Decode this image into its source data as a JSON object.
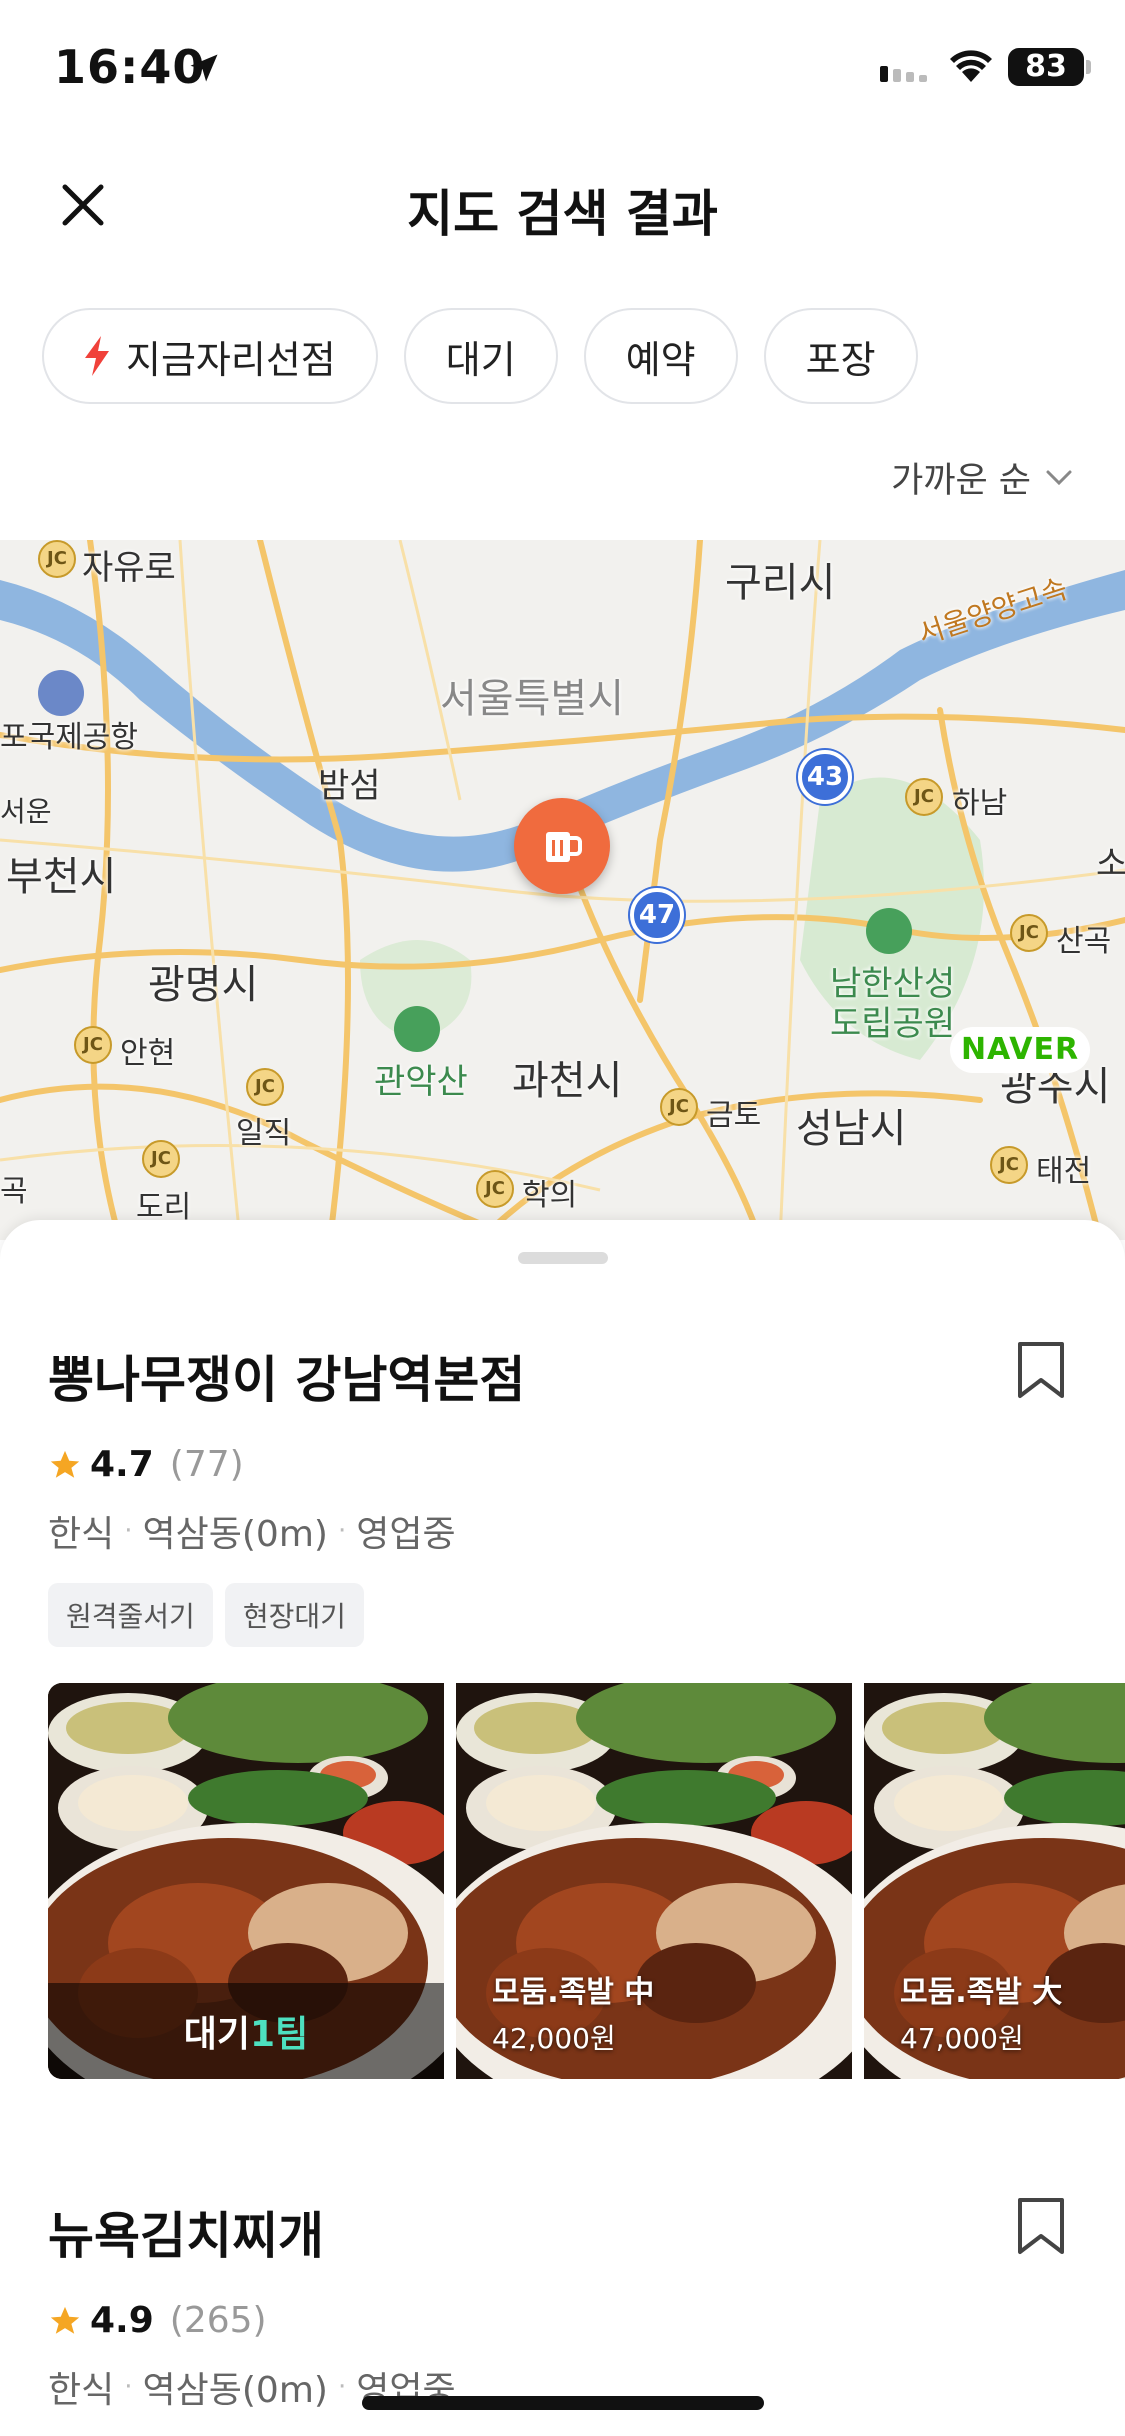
{
  "status_bar": {
    "time": "16:40",
    "battery": "83"
  },
  "header": {
    "title": "지도 검색 결과"
  },
  "filters": [
    {
      "label": "지금자리선점",
      "icon": "bolt-icon"
    },
    {
      "label": "대기"
    },
    {
      "label": "예약"
    },
    {
      "label": "포장"
    }
  ],
  "sort": {
    "label": "가까운 순"
  },
  "map": {
    "labels": {
      "jayuro": "자유로",
      "gurisi": "구리시",
      "seoul_yangyang": "서울양양고속",
      "seoul": "서울특별시",
      "airport": "포국제공항",
      "bamseom": "밤섬",
      "hanam": "하남",
      "seoun": "서운",
      "bucheon": "부천시",
      "sangok": "산곡",
      "gwangmyeong": "광명시",
      "namhansan": "남한산성",
      "dorip": "도립공원",
      "anhyeon": "안현",
      "gwanak": "관악산",
      "gwacheon": "과천시",
      "gwangju": "광주시",
      "iljik": "일직",
      "geumto": "금토",
      "seongnam": "성남시",
      "doli": "도리",
      "hagui": "학의",
      "taejeon": "태전",
      "gok": "곡",
      "so": "소"
    },
    "route_43": "43",
    "route_47": "47",
    "jc": "JC",
    "brand": "NAVER",
    "pin_icon": "beer-mug-icon"
  },
  "restaurants": [
    {
      "name": "뽕나무쟁이 강남역본점",
      "rating": "4.7",
      "reviews": "(77)",
      "category": "한식",
      "location": "역삼동(0m)",
      "status": "영업중",
      "tags": [
        "원격줄서기",
        "현장대기"
      ],
      "wait_prefix": "대기",
      "wait_count": "1팀",
      "menus": [
        {
          "name": "모둠.족발 中",
          "price": "42,000원"
        },
        {
          "name": "모둠.족발 大",
          "price": "47,000원"
        }
      ]
    },
    {
      "name": "뉴욕김치찌개",
      "rating": "4.9",
      "reviews": "(265)",
      "category": "한식",
      "location": "역삼동(0m)",
      "status": "영업중"
    }
  ],
  "colors": {
    "accent": "#f06b3e",
    "wait_highlight": "#4de0c0",
    "star": "#f5a623",
    "route": "#3d6fd8",
    "river": "#7fa8d8"
  }
}
